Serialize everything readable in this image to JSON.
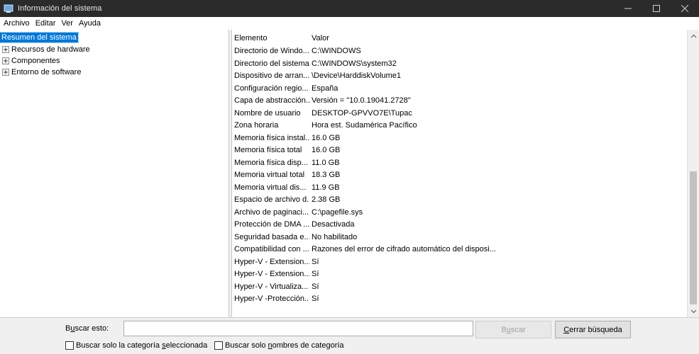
{
  "window": {
    "title": "Información del sistema"
  },
  "menu": [
    {
      "label": "Archivo"
    },
    {
      "label": "Editar"
    },
    {
      "label": "Ver"
    },
    {
      "label": "Ayuda"
    }
  ],
  "tree": [
    {
      "label": "Resumen del sistema",
      "selected": true,
      "expandable": false
    },
    {
      "label": "Recursos de hardware",
      "selected": false,
      "expandable": true
    },
    {
      "label": "Componentes",
      "selected": false,
      "expandable": true
    },
    {
      "label": "Entorno de software",
      "selected": false,
      "expandable": true
    }
  ],
  "table": {
    "headers": [
      "Elemento",
      "Valor"
    ],
    "rows": [
      [
        "Directorio de Windo...",
        "C:\\WINDOWS"
      ],
      [
        "Directorio del sistema",
        "C:\\WINDOWS\\system32"
      ],
      [
        "Dispositivo de arran...",
        "\\Device\\HarddiskVolume1"
      ],
      [
        "Configuración regio...",
        "España"
      ],
      [
        "Capa de abstracción...",
        "Versión = \"10.0.19041.2728\""
      ],
      [
        "Nombre de usuario",
        "DESKTOP-GPVVO7E\\Tupac"
      ],
      [
        "Zona horaria",
        "Hora est. Sudamérica Pacífico"
      ],
      [
        "Memoria física instal...",
        "16.0 GB"
      ],
      [
        "Memoria física total",
        "16.0 GB"
      ],
      [
        "Memoria física disp...",
        "11.0 GB"
      ],
      [
        "Memoria virtual total",
        "18.3 GB"
      ],
      [
        "Memoria virtual dis...",
        "11.9 GB"
      ],
      [
        "Espacio de archivo d...",
        "2.38 GB"
      ],
      [
        "Archivo de paginaci...",
        "C:\\pagefile.sys"
      ],
      [
        "Protección de DMA ...",
        "Desactivada"
      ],
      [
        "Seguridad basada e...",
        "No habilitado"
      ],
      [
        "Compatibilidad con ...",
        "Razones del error de cifrado automático del disposi..."
      ],
      [
        "Hyper-V - Extension...",
        "Sí"
      ],
      [
        "Hyper-V - Extension...",
        "Sí"
      ],
      [
        "Hyper-V - Virtualiza...",
        "Sí"
      ],
      [
        "Hyper-V -Protección...",
        "Sí"
      ]
    ]
  },
  "search": {
    "label_prefix": "B",
    "label_underlined": "u",
    "label_suffix": "scar esto:",
    "value": "",
    "find_button_prefix": "B",
    "find_button_underlined": "u",
    "find_button_suffix": "scar",
    "close_button_prefix": "",
    "close_button_underlined": "C",
    "close_button_suffix": "errar búsqueda",
    "check1_prefix": "Buscar solo la categoría ",
    "check1_underlined": "s",
    "check1_suffix": "eleccionada",
    "check1_checked": false,
    "check2_prefix": "Buscar solo ",
    "check2_underlined": "n",
    "check2_suffix": "ombres de categoría",
    "check2_checked": false
  },
  "colors": {
    "titlebar": "#2b2b2b",
    "selection": "#0078d7",
    "panel": "#f0f0f0"
  },
  "icons": {
    "app": "system-info-icon",
    "minimize": "minimize-icon",
    "maximize": "maximize-icon",
    "close": "close-icon",
    "expand": "plus-box-icon",
    "scroll_up": "chevron-up-icon",
    "scroll_down": "chevron-down-icon"
  }
}
